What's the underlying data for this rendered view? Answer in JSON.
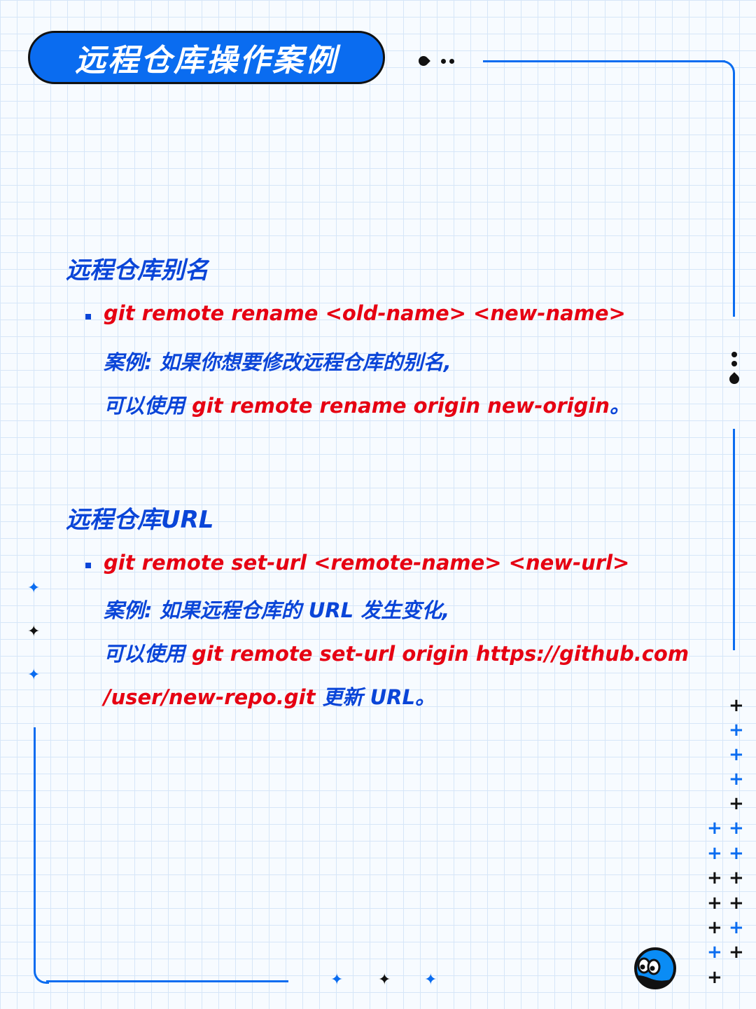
{
  "title": "远程仓库操作案例",
  "section1": {
    "heading": "远程仓库别名",
    "command": "git remote rename <old-name> <new-name>",
    "example_line1": "案例: 如果你想要修改远程仓库的别名,",
    "example_prefix": "可以使用 ",
    "example_code": "git remote rename origin new-origin",
    "example_suffix": "。"
  },
  "section2": {
    "heading": "远程仓库URL",
    "command": "git remote set-url <remote-name> <new-url>",
    "example_line1": "案例: 如果远程仓库的 URL 发生变化,",
    "example_prefix": "可以使用 ",
    "example_code_part1": "git remote set-url origin https://github.com",
    "example_code_part2": "/user/new-repo.git",
    "example_suffix": " 更新 URL。"
  },
  "colors": {
    "accent_blue": "#0a6cf0",
    "text_blue": "#0a45d8",
    "code_red": "#e60012",
    "black": "#111111"
  },
  "icons": [
    "sparkle-icon",
    "plus-icon",
    "mascot-icon",
    "dot-icon",
    "drop-icon"
  ]
}
